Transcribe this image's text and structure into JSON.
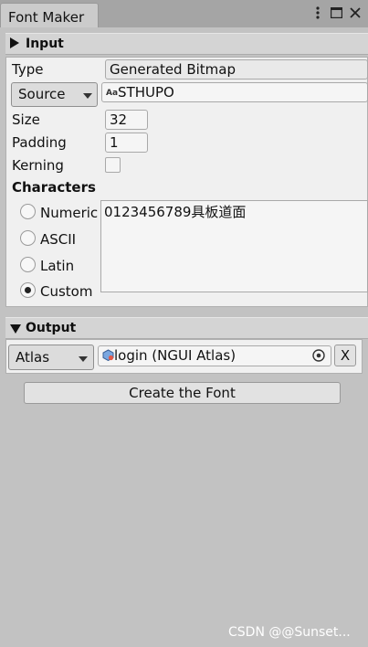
{
  "window": {
    "tab_title": "Font Maker",
    "menu_icon": "kebab-menu-icon",
    "maximize_icon": "maximize-icon",
    "close_icon": "close-icon"
  },
  "input_section": {
    "title": "Input",
    "type_label": "Type",
    "type_value": "Generated Bitmap",
    "source_dropdown": "Source",
    "source_icon": "font-asset-icon",
    "source_icon_text": "Aa",
    "source_value": "STHUPO",
    "size_label": "Size",
    "size_value": "32",
    "padding_label": "Padding",
    "padding_value": "1",
    "kerning_label": "Kerning",
    "kerning_checked": false,
    "characters_label": "Characters",
    "charset_options": [
      {
        "label": "Numeric",
        "selected": false
      },
      {
        "label": "ASCII",
        "selected": false
      },
      {
        "label": "Latin",
        "selected": false
      },
      {
        "label": "Custom",
        "selected": true
      }
    ],
    "characters_value": "0123456789具板道面"
  },
  "output_section": {
    "title": "Output",
    "output_dropdown": "Atlas",
    "atlas_icon": "ngui-atlas-icon",
    "atlas_value": "login (NGUI Atlas)",
    "picker_icon": "object-picker-icon",
    "clear_button": "X"
  },
  "create_button": "Create the Font",
  "watermark": "CSDN @@Sunset..."
}
